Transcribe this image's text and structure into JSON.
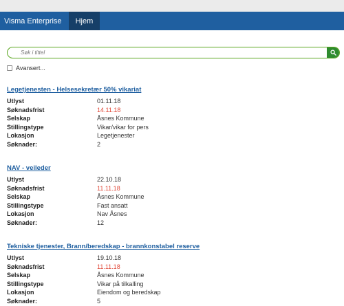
{
  "navbar": {
    "brand": "Visma Enterprise",
    "tab_home": "Hjem"
  },
  "search": {
    "placeholder": "Søk i tittel",
    "button_icon": "search-icon"
  },
  "advanced": {
    "label": "Avansert...",
    "checked": false
  },
  "colors": {
    "navbar": "#1f5fa0",
    "active_tab": "#163f68",
    "link": "#1f5fa0",
    "deadline": "#e04a3a",
    "search_border": "#58a51d",
    "search_button": "#2e8b2e"
  },
  "labels": {
    "published": "Utlyst",
    "deadline": "Søknadsfrist",
    "company": "Selskap",
    "position_type": "Stillingstype",
    "location": "Lokasjon",
    "applications": "Søknader:"
  },
  "jobs": [
    {
      "title": "Legetjenesten - Helsesekretær 50% vikariat",
      "published": "01.11.18",
      "deadline": "14.11.18",
      "company": "Åsnes Kommune",
      "position_type": "Vikar/vikar for pers",
      "location": "Legetjenester",
      "applications": "2"
    },
    {
      "title": "NAV - veileder",
      "published": "22.10.18",
      "deadline": "11.11.18",
      "company": "Åsnes Kommune",
      "position_type": "Fast ansatt",
      "location": "Nav Åsnes",
      "applications": "12"
    },
    {
      "title": "Tekniske tjenester, Brann/beredskap - brannkonstabel reserve",
      "published": "19.10.18",
      "deadline": "11.11.18",
      "company": "Åsnes Kommune",
      "position_type": "Vikar på tilkalling",
      "location": "Eiendom og beredskap",
      "applications": "5"
    }
  ]
}
